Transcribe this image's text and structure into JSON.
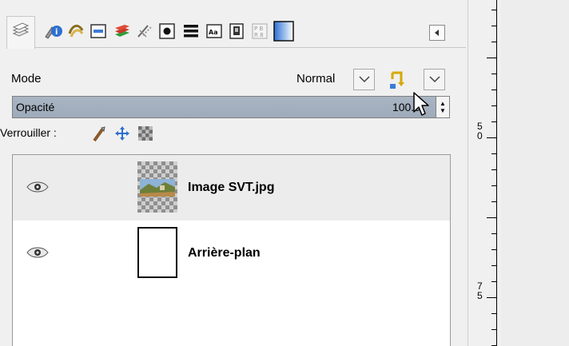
{
  "tabs": [
    {
      "name": "layers-tab-icon",
      "active": true
    },
    {
      "name": "tool-options-tab-icon"
    },
    {
      "name": "paths-tab-icon"
    },
    {
      "name": "undo-history-tab-icon"
    },
    {
      "name": "channels-tab-icon"
    },
    {
      "name": "brushes-tab-icon"
    },
    {
      "name": "pointer-tab-icon"
    },
    {
      "name": "patterns-tab-icon"
    },
    {
      "name": "fonts-tab-icon"
    },
    {
      "name": "document-history-tab-icon"
    },
    {
      "name": "device-status-tab-icon"
    },
    {
      "name": "gradients-tab-icon"
    }
  ],
  "mode": {
    "label": "Mode",
    "value": "Normal"
  },
  "opacity": {
    "label": "Opacité",
    "value": "100.0",
    "fill": 100
  },
  "lock": {
    "label": "Verrouiller :"
  },
  "layers": [
    {
      "name": "Image SVT.jpg",
      "visible": true,
      "selected": true
    },
    {
      "name": "Arrière-plan",
      "visible": true,
      "selected": false
    }
  ],
  "ruler": {
    "labels": [
      "5\n0",
      "7\n5"
    ]
  },
  "colors": {
    "accent": "#9eabba",
    "selection": "#ececec"
  }
}
